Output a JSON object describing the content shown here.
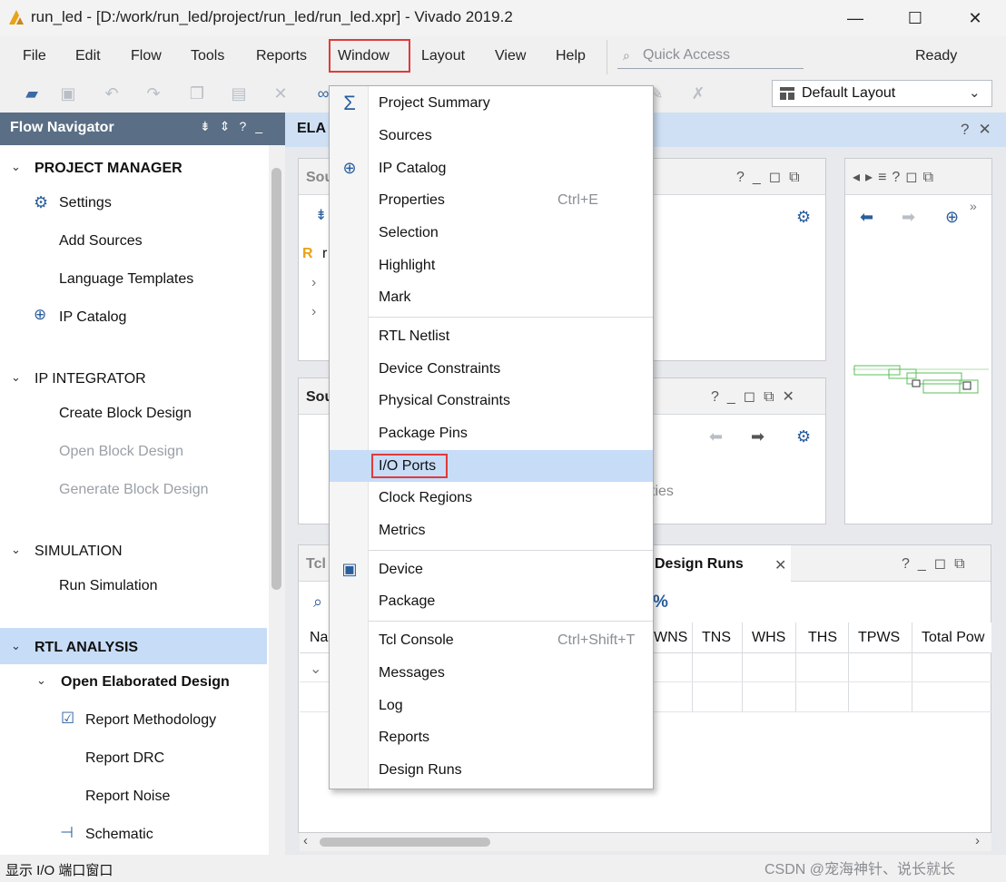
{
  "window": {
    "title": "run_led - [D:/work/run_led/project/run_led/run_led.xpr] - Vivado 2019.2",
    "minimize": "—",
    "maximize": "☐",
    "close": "✕"
  },
  "menubar": {
    "file": "File",
    "edit": "Edit",
    "flow": "Flow",
    "tools": "Tools",
    "reports": "Reports",
    "window": "Window",
    "layout": "Layout",
    "view": "View",
    "help": "Help",
    "quick_access_placeholder": "Quick Access",
    "status": "Ready"
  },
  "toolbar": {
    "layout_select": "Default Layout"
  },
  "flow_navigator": {
    "title": "Flow Navigator",
    "project_manager": "PROJECT MANAGER",
    "settings": "Settings",
    "add_sources": "Add Sources",
    "language_templates": "Language Templates",
    "ip_catalog": "IP Catalog",
    "ip_integrator": "IP INTEGRATOR",
    "create_block_design": "Create Block Design",
    "open_block_design": "Open Block Design",
    "generate_block_design": "Generate Block Design",
    "simulation": "SIMULATION",
    "run_simulation": "Run Simulation",
    "rtl_analysis": "RTL ANALYSIS",
    "open_elaborated_design": "Open Elaborated Design",
    "report_methodology": "Report Methodology",
    "report_drc": "Report DRC",
    "report_noise": "Report Noise",
    "schematic": "Schematic"
  },
  "main": {
    "header": "ELA",
    "sources_panel_title": "Sou",
    "source_file_panel_title": "Sou",
    "tree_root_letter": "R",
    "tree_root_text": "r",
    "properties_hint": "ties",
    "tcl_tab": "Tcl",
    "design_runs_tab": "Design Runs",
    "percent_icon": "%",
    "table_headers": [
      "Na",
      "WNS",
      "TNS",
      "WHS",
      "THS",
      "TPWS",
      "Total Pow"
    ]
  },
  "dropdown": {
    "items": [
      {
        "label": "Project Summary"
      },
      {
        "label": "Sources"
      },
      {
        "label": "IP Catalog"
      },
      {
        "label": "Properties",
        "shortcut": "Ctrl+E"
      },
      {
        "label": "Selection"
      },
      {
        "label": "Highlight"
      },
      {
        "label": "Mark"
      },
      {
        "label": "RTL Netlist"
      },
      {
        "label": "Device Constraints"
      },
      {
        "label": "Physical Constraints"
      },
      {
        "label": "Package Pins"
      },
      {
        "label": "I/O Ports"
      },
      {
        "label": "Clock Regions"
      },
      {
        "label": "Metrics"
      },
      {
        "label": "Device"
      },
      {
        "label": "Package"
      },
      {
        "label": "Tcl Console",
        "shortcut": "Ctrl+Shift+T"
      },
      {
        "label": "Messages"
      },
      {
        "label": "Log"
      },
      {
        "label": "Reports"
      },
      {
        "label": "Design Runs"
      }
    ]
  },
  "statusbar": {
    "text": "显示 I/O 端口窗口",
    "watermark": "CSDN @宠海神针、说长就长"
  },
  "colors": {
    "accent_blue": "#c7dcf7",
    "flow_nav_header": "#5a6e85",
    "highlight_box": "#e03a3a"
  }
}
